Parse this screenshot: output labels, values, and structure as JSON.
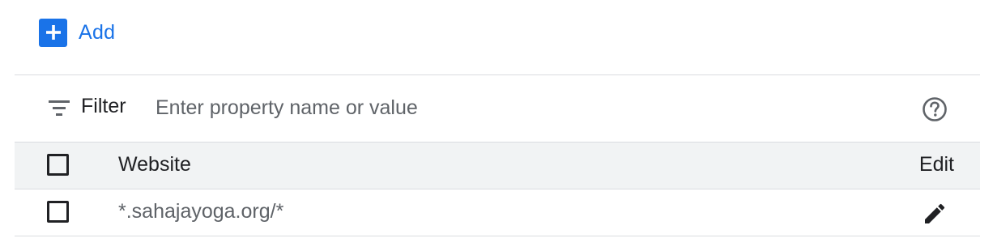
{
  "toolbar": {
    "add_label": "Add",
    "add_icon": "plus-icon",
    "accent_color": "#1a73e8"
  },
  "filter": {
    "label": "Filter",
    "placeholder": "Enter property name or value",
    "value": "",
    "filter_icon": "filter-list-icon",
    "help_icon": "help-circle-icon"
  },
  "table": {
    "columns": {
      "website": "Website",
      "edit": "Edit"
    },
    "rows": [
      {
        "website": "*.sahajayoga.org/*",
        "checked": false,
        "edit_icon": "pencil-icon"
      }
    ]
  }
}
